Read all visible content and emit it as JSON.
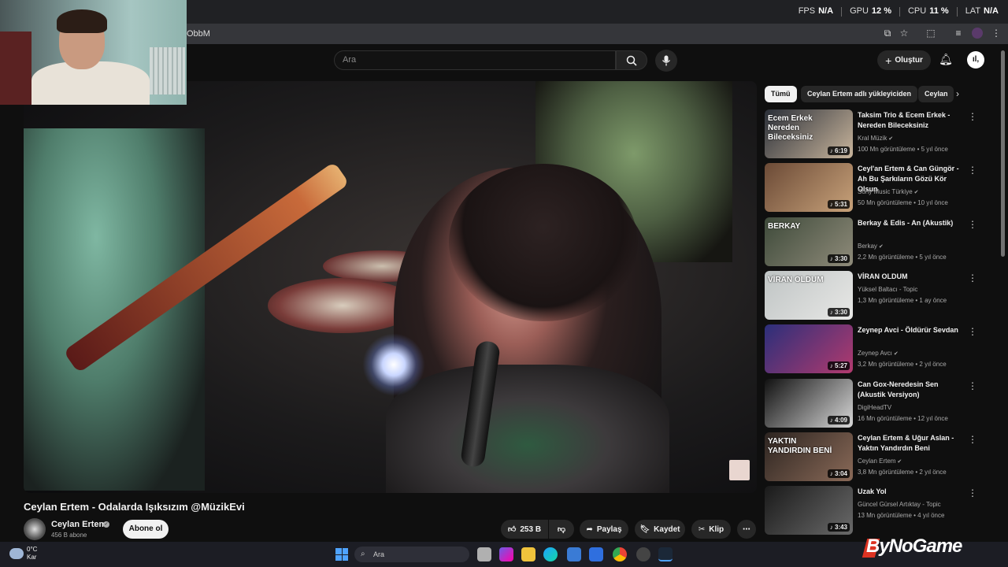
{
  "perf": {
    "fps_label": "FPS",
    "fps_value": "N/A",
    "gpu_label": "GPU",
    "gpu_value": "12 %",
    "cpu_label": "CPU",
    "cpu_value": "11 %",
    "lat_label": "LAT",
    "lat_value": "N/A"
  },
  "browser": {
    "url_fragment": "ObbM"
  },
  "header": {
    "search_placeholder": "Ara",
    "create_label": "Oluştur",
    "avatar_initials": "ıl,"
  },
  "video": {
    "title": "Ceylan Ertem - Odalarda Işıksızım @MüzikEvi",
    "channel_name": "Ceylan Ertem",
    "channel_subs": "456 B abone",
    "subscribe_label": "Abone ol",
    "like_count": "253 B",
    "share_label": "Paylaş",
    "save_label": "Kaydet",
    "clip_label": "Klip",
    "more_label": "⋯"
  },
  "chips": [
    "Tümü",
    "Ceylan Ertem adlı yükleyiciden",
    "Ceylan"
  ],
  "recommendations": [
    {
      "title": "Taksim Trio & Ecem Erkek - Nereden Bileceksiniz",
      "channel": "Kral Müzik",
      "verified": true,
      "meta": "100 Mn görüntüleme • 5 yıl önce",
      "duration": "♪ 6:19",
      "thumb_text": "Ecem Erkek\nNereden\nBileceksiniz",
      "colors": [
        "#2a2f38",
        "#c9b59c"
      ]
    },
    {
      "title": "Ceyl'an Ertem & Can Güngör - Ah Bu Şarkıların Gözü Kör Olsun",
      "channel": "Sony Music Türkiye",
      "verified": true,
      "meta": "50 Mn görüntüleme • 10 yıl önce",
      "duration": "♪ 5:31",
      "thumb_text": "",
      "colors": [
        "#6b4a36",
        "#c8a27a"
      ]
    },
    {
      "title": "Berkay & Edis - An (Akustik)",
      "channel": "Berkay",
      "verified": true,
      "meta": "2,2 Mn görüntüleme • 5 yıl önce",
      "duration": "♪ 3:30",
      "thumb_text": "BERKAY",
      "colors": [
        "#3e4a3a",
        "#8f8b7a"
      ]
    },
    {
      "title": "VİRAN OLDUM",
      "channel": "Yüksel Baltacı - Topic",
      "verified": false,
      "meta": "1,3 Mn görüntüleme • 1 ay önce",
      "duration": "♪ 3:30",
      "thumb_text": "VİRAN OLDUM",
      "colors": [
        "#bfc4c4",
        "#e8e8e6"
      ]
    },
    {
      "title": "Zeynep Avci - Öldürür Sevdan",
      "channel": "Zeynep Avcı",
      "verified": true,
      "meta": "3,2 Mn görüntüleme • 2 yıl önce",
      "duration": "♪ 5:27",
      "thumb_text": "",
      "colors": [
        "#2b2f7a",
        "#b23a6e"
      ]
    },
    {
      "title": "Can Gox-Neredesin Sen (Akustik Versiyon)",
      "channel": "DigiHeadTV",
      "verified": false,
      "meta": "16 Mn görüntüleme • 12 yıl önce",
      "duration": "♪ 4:09",
      "thumb_text": "",
      "colors": [
        "#111111",
        "#d8d8d8"
      ]
    },
    {
      "title": "Ceylan Ertem & Uğur Aslan - Yaktın Yandırdın Beni",
      "channel": "Ceylan Ertem",
      "verified": true,
      "meta": "3,8 Mn görüntüleme • 2 yıl önce",
      "duration": "♪ 3:04",
      "thumb_text": "YAKTIN\nYANDIRDIN BENİ",
      "colors": [
        "#2c2420",
        "#8a6a58"
      ]
    },
    {
      "title": "Uzak Yol",
      "channel": "Güncel Gürsel Artıktay - Topic",
      "verified": false,
      "meta": "13 Mn görüntüleme • 4 yıl önce",
      "duration": "♪ 3:43",
      "thumb_text": "",
      "colors": [
        "#1a1a1a",
        "#6a6a6a"
      ]
    }
  ],
  "taskbar": {
    "weather_temp": "0°C",
    "weather_place": "Kar",
    "search_placeholder": "Ara"
  },
  "brand": {
    "name": "ByNoGame"
  },
  "colors": {
    "accent": "#ff0000",
    "chip_active_bg": "#f1f1f1",
    "bg": "#0f0f0f"
  }
}
